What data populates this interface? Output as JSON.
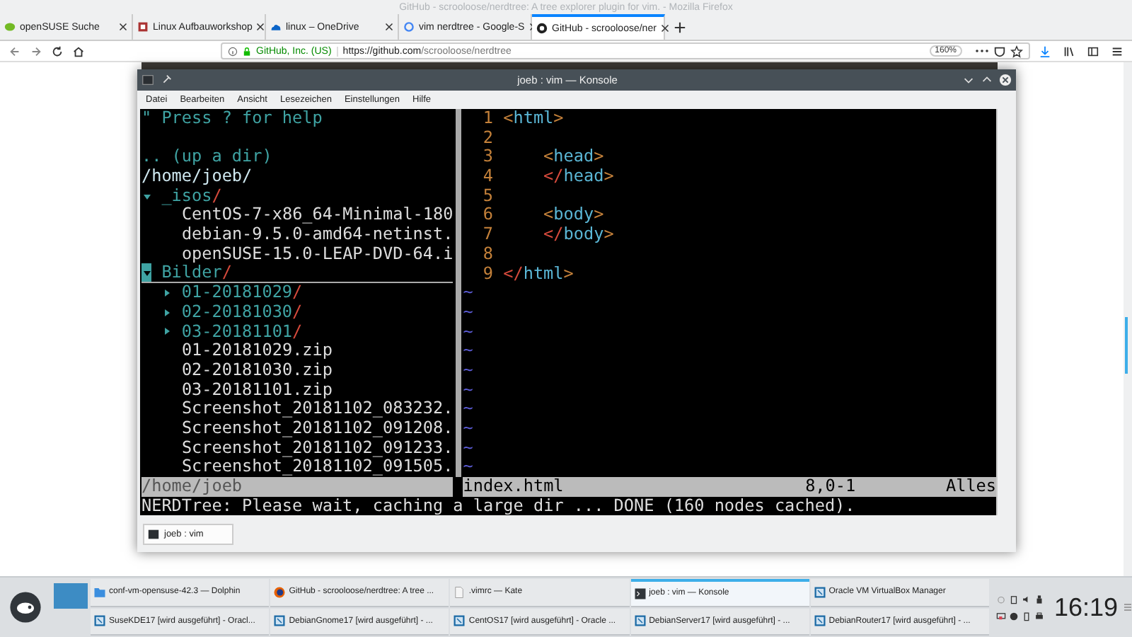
{
  "browser": {
    "title": "GitHub - scrooloose/nerdtree: A tree explorer plugin for vim. - Mozilla Firefox",
    "tabs": [
      {
        "title": "openSUSE Suche",
        "selected": false
      },
      {
        "title": "Linux Aufbauworkshop",
        "selected": false
      },
      {
        "title": "linux – OneDrive",
        "selected": false
      },
      {
        "title": "vim nerdtree - Google-S",
        "selected": false
      },
      {
        "title": "GitHub - scrooloose/ner",
        "selected": true
      }
    ],
    "identity": "GitHub, Inc. (US)",
    "url_host": "https://github.com",
    "url_path": "/scrooloose/nerdtree",
    "zoom": "160%"
  },
  "konsole": {
    "title": "joeb : vim — Konsole",
    "menu": [
      "Datei",
      "Bearbeiten",
      "Ansicht",
      "Lesezeichen",
      "Einstellungen",
      "Hilfe"
    ],
    "help": "\" Press ? for help",
    "up_dir": ".. (up a dir)",
    "root": "/home/joeb/",
    "tree": [
      {
        "kind": "dir",
        "name": "_isos/",
        "expanded": true,
        "selected": false,
        "children": [
          {
            "kind": "file",
            "name": "CentOS-7-x86_64-Minimal-180",
            "selected": false
          },
          {
            "kind": "file",
            "name": "debian-9.5.0-amd64-netinst.",
            "selected": false
          },
          {
            "kind": "file",
            "name": "openSUSE-15.0-LEAP-DVD-64.i",
            "selected": false
          }
        ]
      },
      {
        "kind": "dir",
        "name": "Bilder/",
        "expanded": true,
        "selected": true,
        "children": [
          {
            "kind": "dir",
            "name": "01-20181029/",
            "expanded": false,
            "selected": false
          },
          {
            "kind": "dir",
            "name": "02-20181030/",
            "expanded": false,
            "selected": false
          },
          {
            "kind": "dir",
            "name": "03-20181101/",
            "expanded": false,
            "selected": false
          },
          {
            "kind": "file",
            "name": "01-20181029.zip",
            "selected": false
          },
          {
            "kind": "file",
            "name": "02-20181030.zip",
            "selected": false
          },
          {
            "kind": "file",
            "name": "03-20181101.zip",
            "selected": false
          },
          {
            "kind": "file",
            "name": "Screenshot_20181102_083232.",
            "selected": false
          },
          {
            "kind": "file",
            "name": "Screenshot_20181102_091208.",
            "selected": false
          },
          {
            "kind": "file",
            "name": "Screenshot_20181102_091233.",
            "selected": false
          },
          {
            "kind": "file",
            "name": "Screenshot_20181102_091505.",
            "selected": false
          }
        ]
      }
    ],
    "code": [
      {
        "number": "1",
        "code": "<html>"
      },
      {
        "number": "2"
      },
      {
        "number": "3",
        "code": "    <head>"
      },
      {
        "number": "4",
        "code": "    </head>"
      },
      {
        "number": "5"
      },
      {
        "number": "6",
        "code": "    <body>"
      },
      {
        "number": "7",
        "code": "    </body>"
      },
      {
        "number": "8"
      },
      {
        "number": "9",
        "code": "</html>"
      }
    ],
    "filler": [
      "~",
      "~",
      "~",
      "~",
      "~",
      "~",
      "~",
      "~",
      "~",
      "~"
    ],
    "status_left": "/home/joeb",
    "status_file": "index.html",
    "status_pos": "8,0-1",
    "status_scroll": "Alles",
    "message": "NERDTree: Please wait, caching a large dir ... DONE (160 nodes cached).",
    "tab": "joeb : vim"
  },
  "taskbar": {
    "tasks": [
      {
        "label": "conf-vm-opensuse-42.3 — Dolphin",
        "selected": false
      },
      {
        "label": "GitHub - scrooloose/nerdtree: A tree ...",
        "selected": false
      },
      {
        "label": ".vimrc  — Kate",
        "selected": false
      },
      {
        "label": "joeb : vim — Konsole",
        "selected": true
      },
      {
        "label": "Oracle VM VirtualBox Manager",
        "selected": false
      },
      {
        "label": "SuseKDE17 [wird ausgeführt] - Oracl...",
        "selected": false
      },
      {
        "label": "DebianGnome17 [wird ausgeführt] - ...",
        "selected": false
      },
      {
        "label": "CentOS17 [wird ausgeführt] - Oracle ...",
        "selected": false
      },
      {
        "label": "DebianServer17 [wird ausgeführt] - ...",
        "selected": false
      },
      {
        "label": "DebianRouter17 [wird ausgeführt] - ...",
        "selected": false
      }
    ],
    "clock": "16:19"
  }
}
